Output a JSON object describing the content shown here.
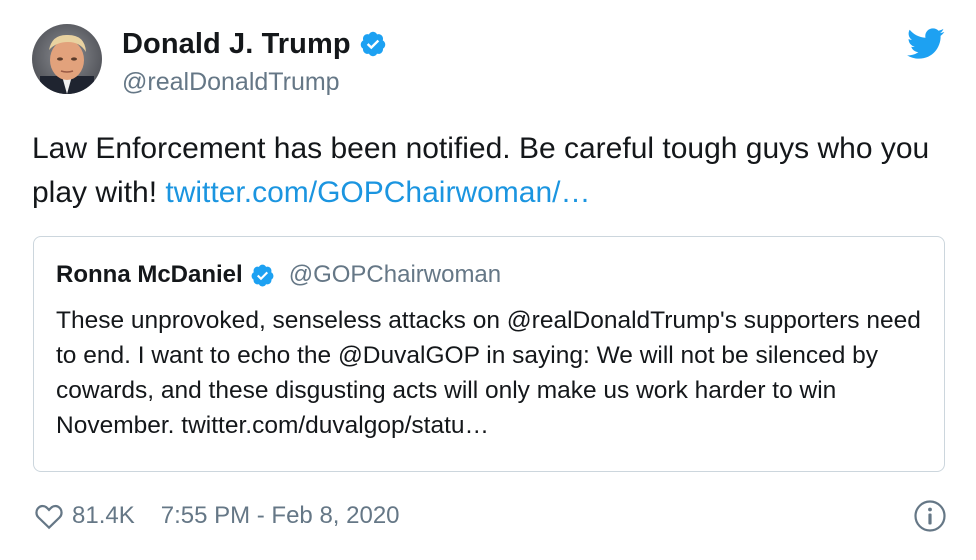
{
  "author": {
    "display_name": "Donald J. Trump",
    "handle": "@realDonaldTrump"
  },
  "tweet": {
    "text": "Law Enforcement has been notified. Be careful tough guys who you play with! ",
    "link": "twitter.com/GOPChairwoman/…"
  },
  "quote": {
    "display_name": "Ronna McDaniel",
    "handle": "@GOPChairwoman",
    "text": "These unprovoked, senseless attacks on @realDonaldTrump's supporters need to end. I want to echo the @DuvalGOP in saying: We will not be silenced by cowards, and these disgusting acts will only make us work harder to win November. twitter.com/duvalgop/statu…"
  },
  "footer": {
    "likes": "81.4K",
    "timestamp": "7:55 PM - Feb 8, 2020"
  },
  "colors": {
    "accent": "#1da1f2",
    "link": "#1b95e0",
    "secondary_text": "#657786",
    "border": "#ccd6dd"
  },
  "icons": [
    "verified-badge-icon",
    "twitter-bird-icon",
    "heart-icon",
    "info-icon"
  ]
}
